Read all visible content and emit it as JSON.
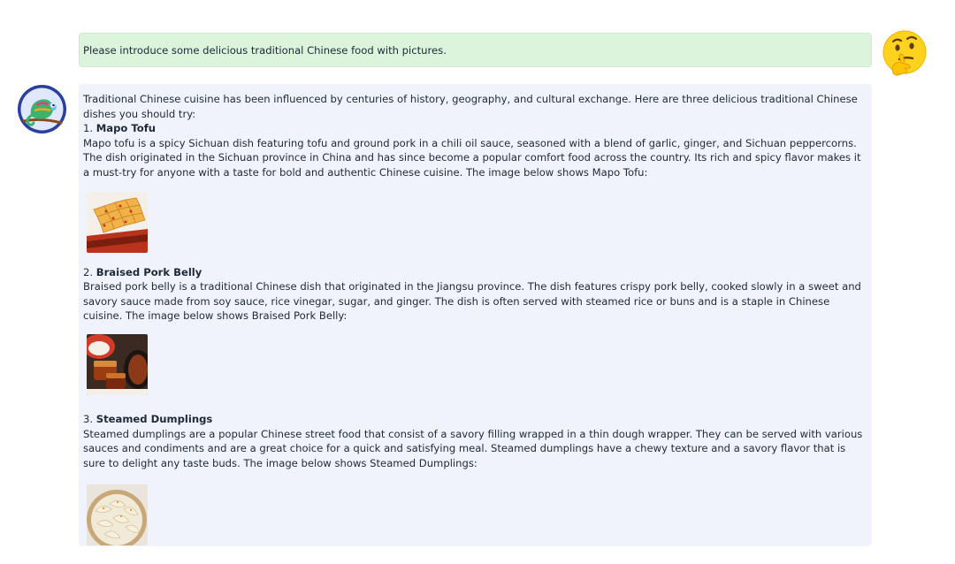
{
  "user_message": {
    "text": "Please introduce some delicious traditional Chinese food with pictures.",
    "avatar_icon": "thinking-face-emoji-icon"
  },
  "bot_message": {
    "avatar_icon": "chameleon-avatar-icon",
    "intro": "Traditional Chinese cuisine has been influenced by centuries of history, geography, and cultural exchange. Here are three delicious traditional Chinese dishes you should try:",
    "dishes": [
      {
        "number": "1.",
        "name": "Mapo Tofu",
        "description": "Mapo tofu is a spicy Sichuan dish featuring tofu and ground pork in a chili oil sauce, seasoned with a blend of garlic, ginger, and Sichuan peppercorns. The dish originated in the Sichuan province in China and has since become a popular comfort food across the country. Its rich and spicy flavor makes it a must-try for anyone with a taste for bold and authentic Chinese cuisine. The image below shows Mapo Tofu:"
      },
      {
        "number": "2.",
        "name": "Braised Pork Belly",
        "description": "Braised pork belly is a traditional Chinese dish that originated in the Jiangsu province. The dish features crispy pork belly, cooked slowly in a sweet and savory sauce made from soy sauce, rice vinegar, sugar, and ginger. The dish is often served with steamed rice or buns and is a staple in Chinese cuisine. The image below shows Braised Pork Belly:"
      },
      {
        "number": "3.",
        "name": "Steamed Dumplings",
        "description": "Steamed dumplings are a popular Chinese street food that consist of a savory filling wrapped in a thin dough wrapper. They can be served with various sauces and condiments and are a great choice for a quick and satisfying meal. Steamed dumplings have a chewy texture and a savory flavor that is sure to delight any taste buds. The image below shows Steamed Dumplings:"
      }
    ]
  },
  "colors": {
    "user_bubble_bg": "#dcf3dc",
    "bot_bubble_bg": "#f0f3fc",
    "text": "#1f2937"
  }
}
